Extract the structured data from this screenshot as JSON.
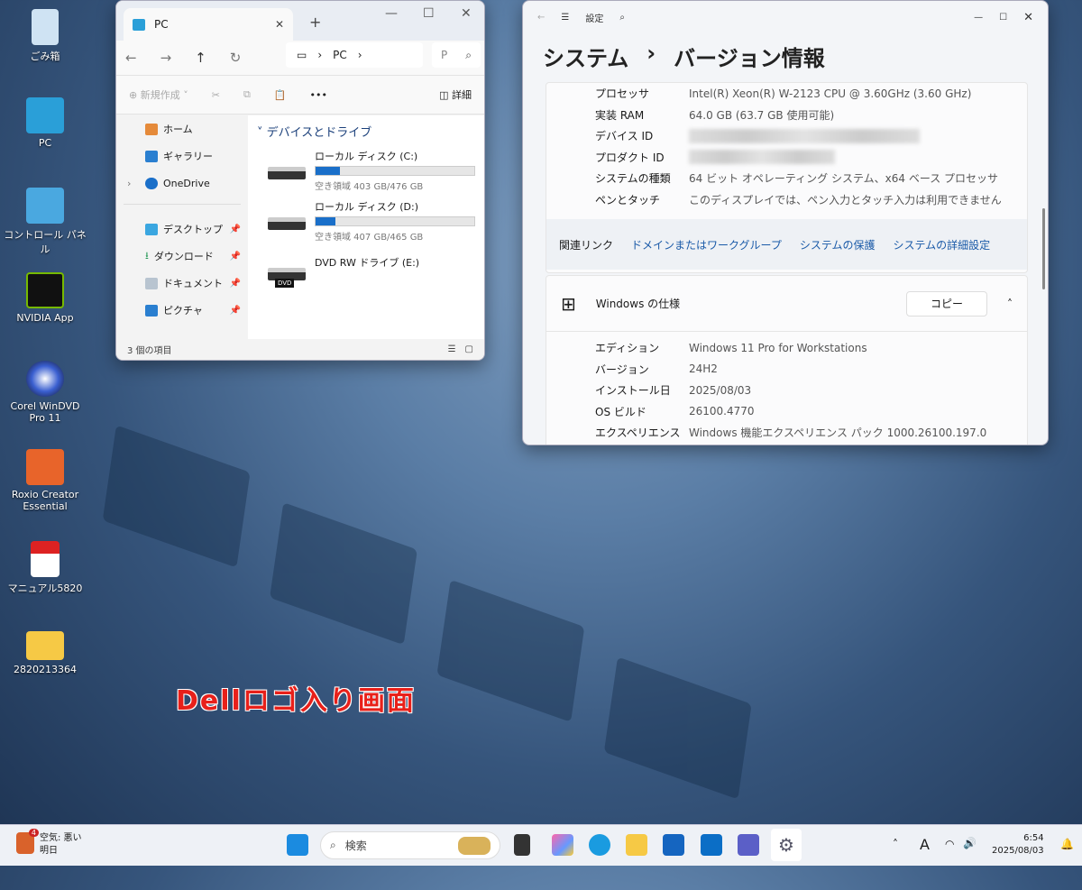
{
  "desktop": {
    "icons": [
      {
        "label": "ごみ箱",
        "icon": "recycle-bin-icon"
      },
      {
        "label": "PC",
        "icon": "pc-icon"
      },
      {
        "label": "コントロール パネル",
        "icon": "control-panel-icon"
      },
      {
        "label": "NVIDIA App",
        "icon": "nvidia-icon"
      },
      {
        "label": "Corel WinDVD Pro 11",
        "icon": "windvd-icon"
      },
      {
        "label": "Roxio Creator Essential",
        "icon": "roxio-icon"
      },
      {
        "label": "マニュアル5820",
        "icon": "pdf-icon"
      },
      {
        "label": "2820213364",
        "icon": "folder-icon"
      }
    ],
    "caption": "Dellロゴ入り画面"
  },
  "explorer": {
    "tab_title": "PC",
    "breadcrumb": [
      "PC"
    ],
    "search_placeholder": "P",
    "toolbar": {
      "new": "新規作成",
      "more": "•••",
      "details": "詳細"
    },
    "sidebar": [
      {
        "label": "ホーム"
      },
      {
        "label": "ギャラリー"
      },
      {
        "label": "OneDrive"
      },
      {
        "label": "デスクトップ"
      },
      {
        "label": "ダウンロード"
      },
      {
        "label": "ドキュメント"
      },
      {
        "label": "ピクチャ"
      }
    ],
    "group": "デバイスとドライブ",
    "drives": [
      {
        "name": "ローカル ディスク (C:)",
        "free": "空き領域 403 GB/476 GB",
        "used_fraction": 0.153
      },
      {
        "name": "ローカル ディスク (D:)",
        "free": "空き領域 407 GB/465 GB",
        "used_fraction": 0.125
      },
      {
        "name": "DVD RW ドライブ (E:)",
        "badge": "DVD"
      }
    ],
    "status": "3 個の項目"
  },
  "settings": {
    "app": "設定",
    "breadcrumb": [
      "システム",
      "›",
      "バージョン情報"
    ],
    "device_specs": [
      {
        "k": "プロセッサ",
        "v": "Intel(R) Xeon(R) W-2123 CPU @ 3.60GHz (3.60 GHz)"
      },
      {
        "k": "実装 RAM",
        "v": "64.0 GB (63.7 GB 使用可能)"
      },
      {
        "k": "デバイス ID"
      },
      {
        "k": "プロダクト ID"
      },
      {
        "k": "システムの種類",
        "v": "64 ビット オペレーティング システム、x64 ベース プロセッサ"
      },
      {
        "k": "ペンとタッチ",
        "v": "このディスプレイでは、ペン入力とタッチ入力は利用できません"
      }
    ],
    "related_label": "関連リンク",
    "related_links": [
      "ドメインまたはワークグループ",
      "システムの保護",
      "システムの詳細設定"
    ],
    "win_spec_title": "Windows の仕様",
    "copy": "コピー",
    "win_specs": [
      {
        "k": "エディション",
        "v": "Windows 11 Pro for Workstations"
      },
      {
        "k": "バージョン",
        "v": "24H2"
      },
      {
        "k": "インストール日",
        "v": "2025/08/03"
      },
      {
        "k": "OS ビルド",
        "v": "26100.4770"
      },
      {
        "k": "エクスペリエンス",
        "v": "Windows 機能エクスペリエンス パック 1000.26100.197.0"
      }
    ]
  },
  "taskbar": {
    "weather_badge": "4",
    "weather": "空気: 悪い",
    "weather_sub": "明日",
    "search": "検索",
    "time": "6:54",
    "date": "2025/08/03",
    "ime": "A"
  }
}
